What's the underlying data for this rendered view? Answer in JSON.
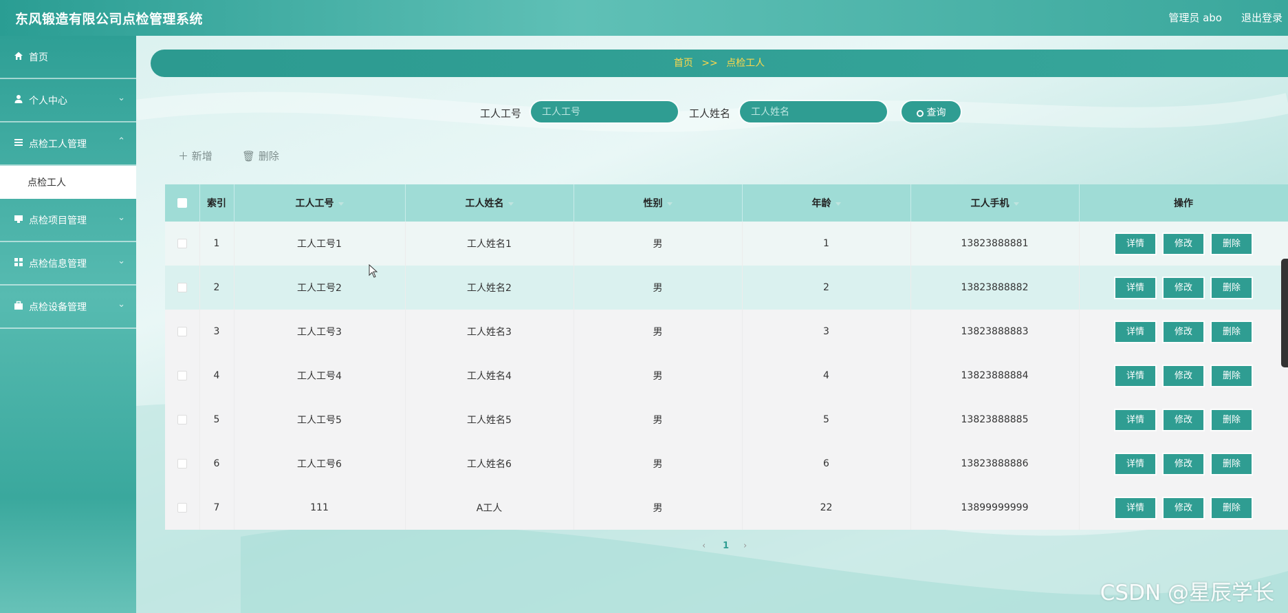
{
  "header": {
    "brand": "东风锻造有限公司点检管理系统",
    "user": "管理员 abo",
    "logout": "退出登录"
  },
  "sidebar": {
    "items": [
      {
        "label": "首页",
        "icon": "home-icon"
      },
      {
        "label": "个人中心",
        "icon": "user-icon"
      },
      {
        "label": "点检工人管理",
        "icon": "list-icon"
      },
      {
        "label": "点检项目管理",
        "icon": "monitor-icon"
      },
      {
        "label": "点检信息管理",
        "icon": "grid-icon"
      },
      {
        "label": "点检设备管理",
        "icon": "briefcase-icon"
      }
    ],
    "sub_item": "点检工人"
  },
  "breadcrumb": {
    "home": "首页",
    "sep": ">>",
    "current": "点检工人"
  },
  "search": {
    "id_label": "工人工号",
    "id_placeholder": "工人工号",
    "name_label": "工人姓名",
    "name_placeholder": "工人姓名",
    "query_button": "查询"
  },
  "actions": {
    "add": "新增",
    "delete": "删除"
  },
  "table": {
    "headers": [
      "索引",
      "工人工号",
      "工人姓名",
      "性别",
      "年龄",
      "工人手机",
      "操作"
    ],
    "rows": [
      {
        "index": "1",
        "id": "工人工号1",
        "name": "工人姓名1",
        "gender": "男",
        "age": "1",
        "phone": "13823888881"
      },
      {
        "index": "2",
        "id": "工人工号2",
        "name": "工人姓名2",
        "gender": "男",
        "age": "2",
        "phone": "13823888882"
      },
      {
        "index": "3",
        "id": "工人工号3",
        "name": "工人姓名3",
        "gender": "男",
        "age": "3",
        "phone": "13823888883"
      },
      {
        "index": "4",
        "id": "工人工号4",
        "name": "工人姓名4",
        "gender": "男",
        "age": "4",
        "phone": "13823888884"
      },
      {
        "index": "5",
        "id": "工人工号5",
        "name": "工人姓名5",
        "gender": "男",
        "age": "5",
        "phone": "13823888885"
      },
      {
        "index": "6",
        "id": "工人工号6",
        "name": "工人姓名6",
        "gender": "男",
        "age": "6",
        "phone": "13823888886"
      },
      {
        "index": "7",
        "id": "111",
        "name": "A工人",
        "gender": "男",
        "age": "22",
        "phone": "13899999999"
      }
    ],
    "ops": {
      "detail": "详情",
      "edit": "修改",
      "delete": "删除"
    }
  },
  "pagination": {
    "prev": "‹",
    "page": "1",
    "next": "›"
  },
  "watermark": "CSDN @星辰学长",
  "colors": {
    "primary": "#2f9d92",
    "header_bg": "#9fdcd6",
    "breadcrumb_text": "#ffd84a"
  }
}
